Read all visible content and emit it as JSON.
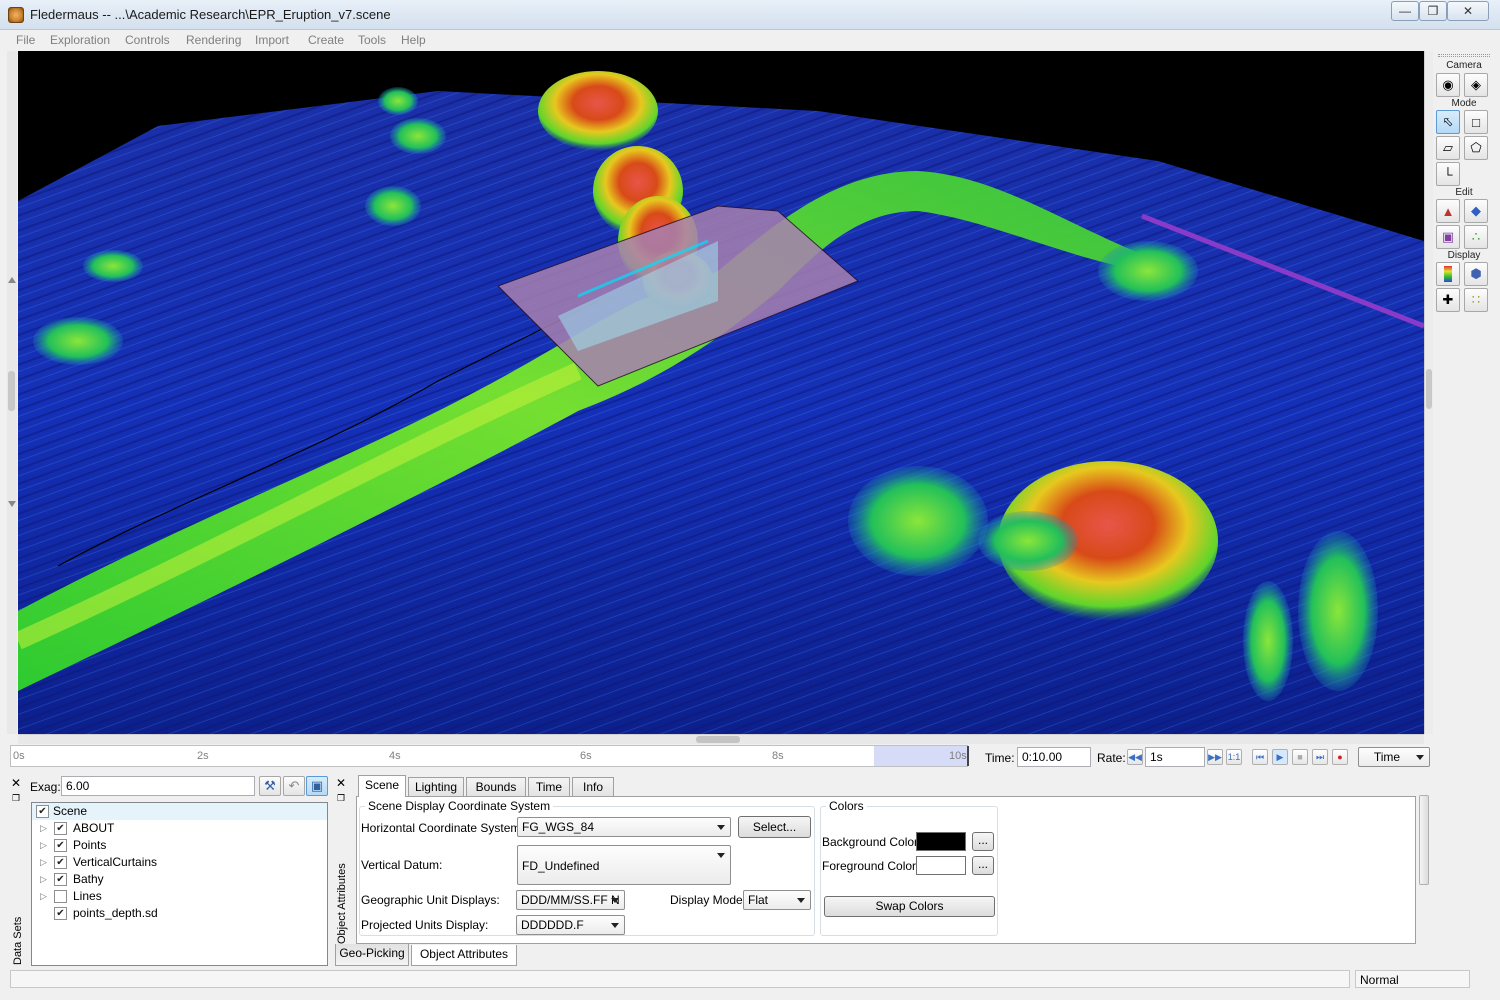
{
  "window": {
    "title": "Fledermaus -- ...\\Academic Research\\EPR_Eruption_v7.scene",
    "min_icon": "minimize-icon",
    "max_icon": "maximize-icon",
    "close_icon": "close-icon"
  },
  "menu": [
    "File",
    "Exploration",
    "Controls",
    "Rendering",
    "Import",
    "Create",
    "Tools",
    "Help"
  ],
  "toolbox": {
    "sections": [
      "Camera",
      "Mode",
      "Edit",
      "Display"
    ],
    "camera_buttons": [
      "camera-icon",
      "camera-add-icon"
    ],
    "mode_buttons": [
      "pointer-icon",
      "rect-select-icon",
      "lasso-icon",
      "polygon-select-icon",
      "ruler-icon"
    ],
    "edit_buttons": [
      "surface-edit-icon",
      "surface-paint-icon",
      "box-edit-icon",
      "points-edit-icon"
    ],
    "display_buttons": [
      "colormap-icon",
      "cube-view-icon",
      "crosshair-icon",
      "scatter-icon"
    ]
  },
  "timeline": {
    "ticks": [
      "0s",
      "2s",
      "4s",
      "6s",
      "8s",
      "10s"
    ],
    "time_label": "Time:",
    "time_value": "0:10.00",
    "rate_label": "Rate:",
    "rate_value": "1s",
    "one_to_one": "1:1",
    "mode": "Time"
  },
  "datasets": {
    "panel_label": "Data Sets",
    "exag_label": "Exag:",
    "exag_value": "6.00",
    "root": {
      "label": "Scene",
      "checked": true
    },
    "items": [
      {
        "label": "ABOUT",
        "checked": true,
        "expandable": true
      },
      {
        "label": "Points",
        "checked": true,
        "expandable": true
      },
      {
        "label": "VerticalCurtains",
        "checked": true,
        "expandable": true
      },
      {
        "label": "Bathy",
        "checked": true,
        "expandable": true
      },
      {
        "label": "Lines",
        "checked": false,
        "expandable": true
      },
      {
        "label": "points_depth.sd",
        "checked": true,
        "expandable": false
      }
    ]
  },
  "attributes": {
    "panel_label": "Object Attributes",
    "tabs": [
      "Scene",
      "Lighting",
      "Bounds",
      "Time",
      "Info"
    ],
    "active_tab": "Scene",
    "coord_group": {
      "title": "Scene Display Coordinate System",
      "horizontal_label": "Horizontal Coordinate System:",
      "horizontal_value": "FG_WGS_84",
      "select_button": "Select...",
      "vertical_label": "Vertical Datum:",
      "vertical_value": "FD_Undefined",
      "geo_units_label": "Geographic Unit Displays:",
      "geo_units_value": "DDD/MM/SS.FF N",
      "display_mode_label": "Display Mode:",
      "display_mode_value": "Flat",
      "proj_units_label": "Projected Units Display:",
      "proj_units_value": "DDDDDD.F"
    },
    "colors_group": {
      "title": "Colors",
      "background_label": "Background Color:",
      "background_color": "#000000",
      "foreground_label": "Foreground Color:",
      "foreground_color": "#ffffff",
      "ellipsis": "...",
      "swap_button": "Swap Colors"
    }
  },
  "bottom_tabs": [
    "Geo-Picking",
    "Object Attributes"
  ],
  "status": {
    "mode": "Normal"
  }
}
